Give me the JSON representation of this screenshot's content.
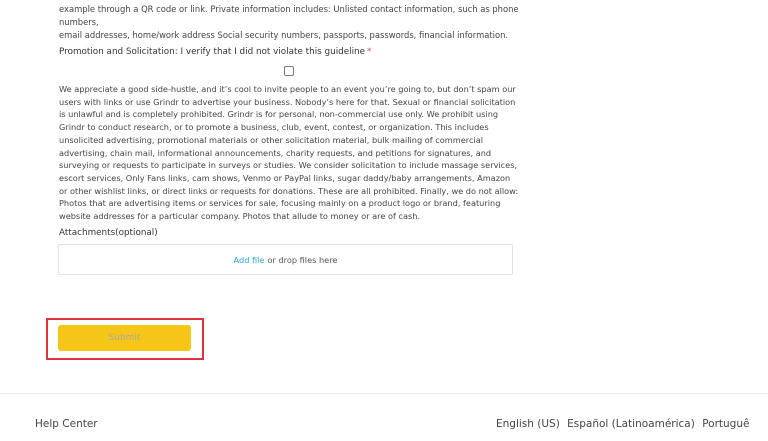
{
  "form": {
    "top_text_line1": "example through a QR code or link. Private information includes: Unlisted contact information, such as phone numbers,",
    "top_text_line2": "email addresses, home/work address Social security numbers, passports, passwords, financial information.",
    "promotion_label": "Promotion and Solicitation: I verify that I did not violate this guideline",
    "required_marker": "*",
    "guideline_text": "We appreciate a good side-hustle, and it’s cool to invite people to an event you’re going to, but don’t spam our users with links or use Grindr to advertise your business. Nobody’s here for that. Sexual or financial solicitation is unlawful and is completely prohibited. Grindr is for personal, non-commercial use only. We prohibit using Grindr to conduct research, or to promote a business, club, event, contest, or organization. This includes unsolicited advertising, promotional materials or other solicitation material, bulk mailing of commercial advertising, chain mail, informational announcements, charity requests, and petitions for signatures, and surveying or requests to participate in surveys or studies. We consider solicitation to include massage services, escort services, Only Fans links, cam shows, Venmo or PayPal links, sugar daddy/baby arrangements, Amazon or other wishlist links, or direct links or requests for donations. These are all prohibited. Finally, we do not allow: Photos that are advertising items or services for sale, focusing mainly on a product logo or brand, featuring website addresses for a particular company. Photos that allude to money or are of cash.",
    "attachments_label": "Attachments(optional)",
    "add_file_link": "Add file",
    "drop_files_text": "or drop files here",
    "submit_label": "Submit"
  },
  "footer": {
    "help_center": "Help Center",
    "languages": [
      "English (US)",
      "Español (Latinoamérica)",
      "Portuguê"
    ]
  },
  "colors": {
    "submit_bg": "#f5c518",
    "link": "#2ea3d6",
    "highlight_border": "#e0323a",
    "required": "#d9534f"
  }
}
